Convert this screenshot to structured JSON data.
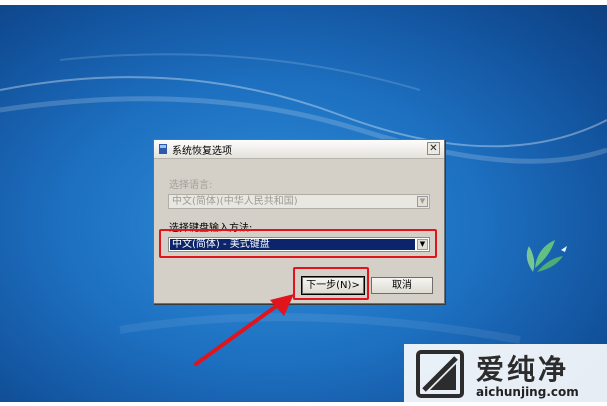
{
  "dialog": {
    "title": "系统恢复选项",
    "close_glyph": "✕",
    "language_label": "选择语言:",
    "language_value": "中文(简体)(中华人民共和国)",
    "keyboard_label": "选择键盘输入方法:",
    "keyboard_value": "中文(简体) - 美式键盘",
    "dropdown_glyph": "▼",
    "next_button": "下一步(N)>",
    "cancel_button": "取消"
  },
  "watermark": {
    "name": "爱纯净",
    "url": "aichunjing.com"
  },
  "colors": {
    "highlight": "#e0141a",
    "selection": "#0b246a",
    "desktop": "#1d6fc0"
  }
}
